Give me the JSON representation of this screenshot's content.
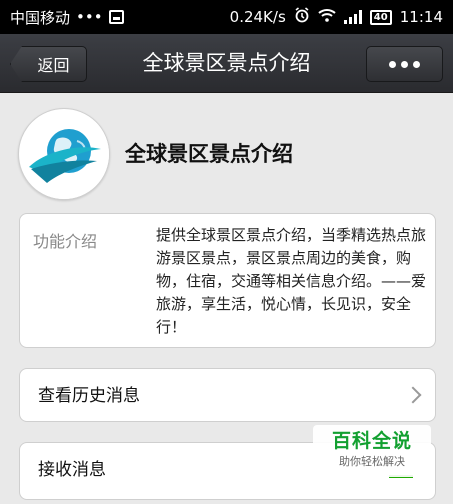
{
  "status_bar": {
    "carrier": "中国移动",
    "dots": "•••",
    "speed": "0.24K/s",
    "battery": "40",
    "time": "11:14"
  },
  "title_bar": {
    "back_label": "返回",
    "title": "全球景区景点介绍",
    "more_label": "•••"
  },
  "profile": {
    "name": "全球景区景点介绍",
    "avatar_icon": "globe-logo-icon"
  },
  "intro": {
    "label": "功能介绍",
    "text": "提供全球景区景点介绍，当季精选热点旅游景区景点，景区景点周边的美食，购物，住宿，交通等相关信息介绍。——爱旅游，享生活，悦心情，长见识，安全行！"
  },
  "menu": {
    "history_label": "查看历史消息",
    "receive_label": "接收消息"
  },
  "watermark": {
    "main": "百科全说",
    "sub": "助你轻松解决"
  },
  "colors": {
    "titlebar": "#2f3034",
    "accent_green": "#12a030",
    "background": "#e9e9e9"
  }
}
